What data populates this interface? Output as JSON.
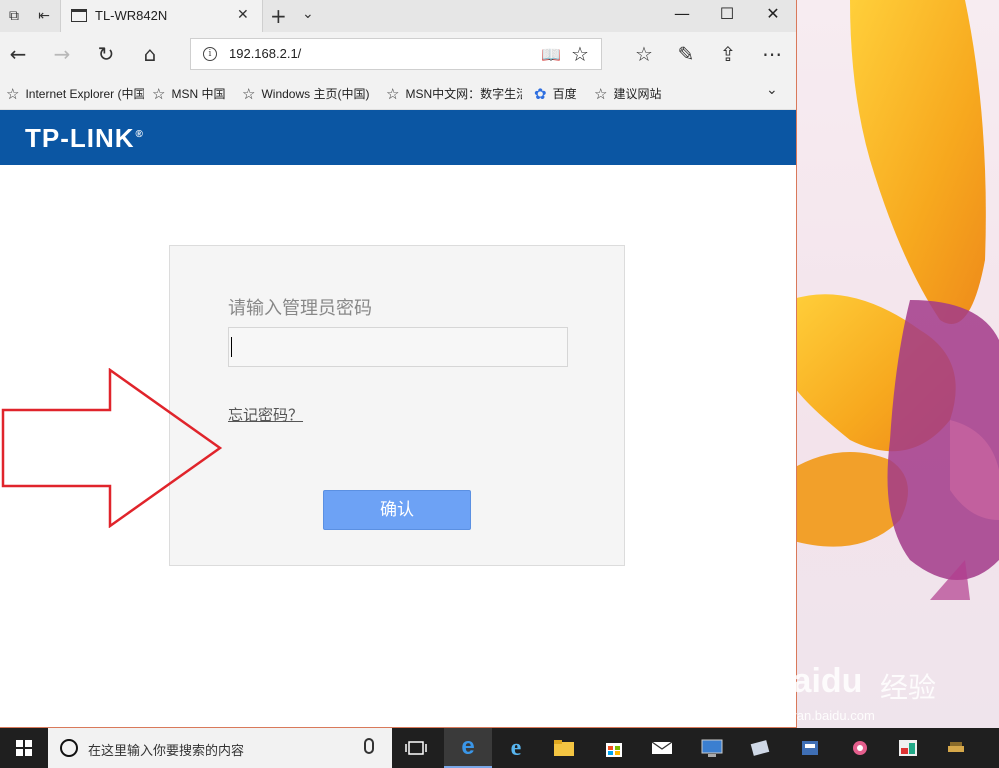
{
  "browser": {
    "tab_title": "TL-WR842N",
    "url": "192.168.2.1/",
    "favorites": [
      {
        "label": "Internet Explorer (中国)",
        "icon": "star-icon"
      },
      {
        "label": "MSN 中国",
        "icon": "star-icon"
      },
      {
        "label": "Windows 主页(中国)",
        "icon": "star-icon"
      },
      {
        "label": "MSN中文网：数字生活",
        "icon": "star-icon"
      },
      {
        "label": "百度",
        "icon": "baidu-paw-icon"
      },
      {
        "label": "建议网站",
        "icon": "star-icon"
      }
    ]
  },
  "page": {
    "brand": "TP-LINK",
    "brand_mark": "®",
    "login_label": "请输入管理员密码",
    "password_value": "",
    "forgot_link": "忘记密码？",
    "confirm_button": "确认",
    "brand_color": "#0b56a3",
    "button_color": "#6da2f5"
  },
  "annotation": {
    "arrow_color": "#e0242b"
  },
  "watermark": {
    "logo": "Baidu",
    "text": "经验",
    "url": "jingyan.baidu.com"
  },
  "taskbar": {
    "search_placeholder": "在这里输入你要搜索的内容"
  }
}
